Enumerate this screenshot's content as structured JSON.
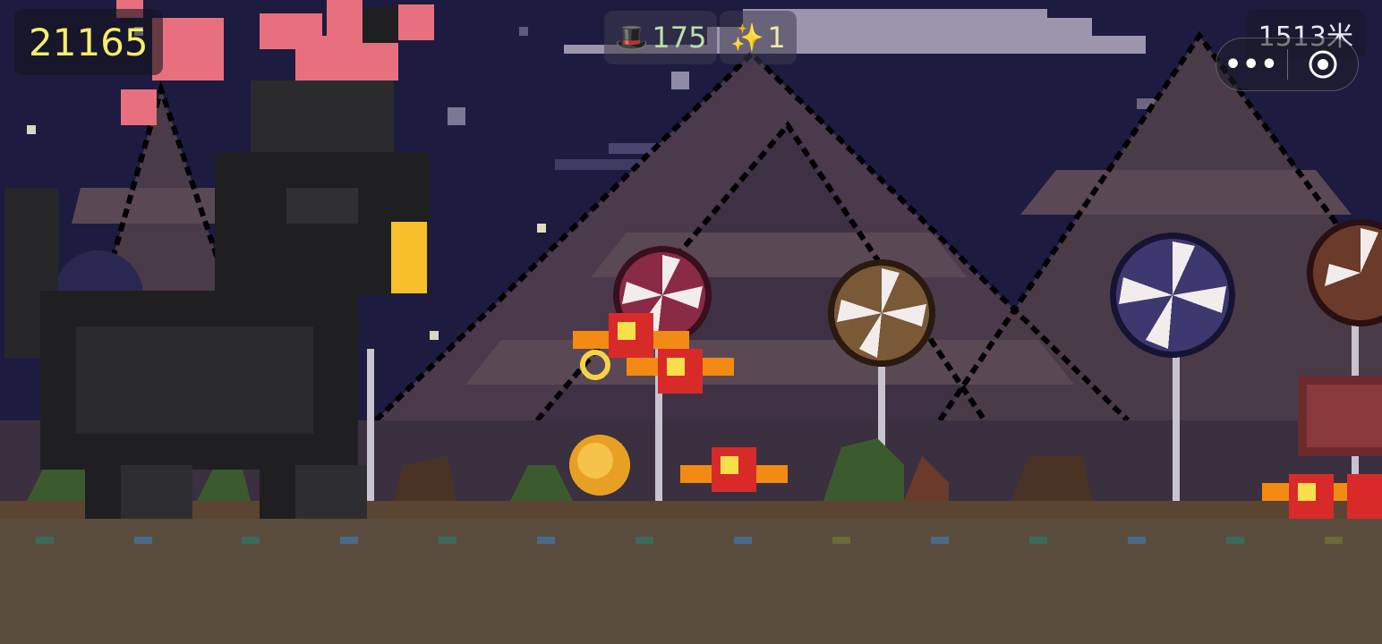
{
  "hud": {
    "score": "21165",
    "hats": {
      "icon": "top-hat-icon",
      "value": "175"
    },
    "sparkles": {
      "icon": "sparkles-icon",
      "value": "1"
    },
    "distance": "1513米"
  },
  "miniprogram_capsule": {
    "menu_icon": "more-dots-icon",
    "close_icon": "target-close-icon"
  },
  "colors": {
    "sky": "#1d1b3f",
    "score_text": "#f5ee6a",
    "counter_text": "#b9e0a8",
    "ground": "#5a4c3c"
  }
}
